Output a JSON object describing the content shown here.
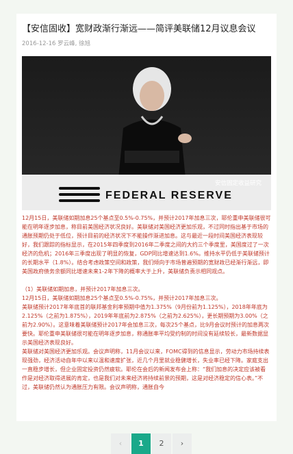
{
  "article": {
    "title": "【安信固收】宽财政渐行渐远——简评美联储12月议息会议",
    "meta": "2016-12-16 罗云峰, 徐旭",
    "image": {
      "podium_text": "FEDERAL RESERVE",
      "watermark": "安信固定收益研究"
    },
    "paragraphs": [
      "12月15日，美联储如期加息25个基点至0.5%-0.75%，并预计2017年加息三次，耶伦重申美联储很可能在明年逐步加息，称目前美国经济状况良好。美联储对美国经济更加乐观，不过同时指出基于市场的通胀预期仍处于低位，预计目前的经济状况下不能操作渐进加息。这与最近一段时间美国经济表现较好，我们跟踪的指标显示，在2015年四季度到2016年二季度之间的大约三个季度里，美国度过了一次经济的危机；2016年三季度出现了明显的恢复，GDP同比增速达到1.6%。维持水平仍低于美联储预计的长期水平（1.8%）。结合考虑政策空间和政策，我们倾向于市场普遍预期的宽财政已经渐行渐远，即美国政府债务余额同比增速未来1-2年下降的概率大于上升，美联储负责示相同观点。"
    ],
    "section_title": "（1）美联储如期加息，并预计2017年加息三次。",
    "section_lines": [
      "12月15日，美联储如期加息25个基点至0.5%-0.75%，并预计2017年加息三次。",
      "美联储预计2017年年底首的联邦基金利率预期中值为1.375%（9月份前为1.125%），2018年年底为2.125%（之前为1.875%），2019年年底前为2.875%（之前为2.625%），更长期预期为3.00%（之前为2.90%）。这意味着美联储预计2017年会加息三次，每次25个基点，比9月会议时预计的加息两次要快。耶伦重申美联储很可能在明年逐步加息，称通胀率平均受约制的时间没有延续较长，最新数据显示美国经济表现良好。",
      "美联储对美国经济更加乐观。会议声明称，11月会议以来，FOMC得到的信息显示，劳动力市场持续表现强劲，经济活动自年中以来以温和速度扩张，近几个月里就业稳健增长，失业率已经下降。家庭支出一直稳步增长，但企业固定投资仍然疲软。耶伦在会后的新闻发布会上称：“我们加息的决定应该被看作是对经济取得进展的肯定，也是我们对未来经济将持续前景的预期，这是对经济稳定的信心表。”不过，美联储仍然认为通胀压力有限。会议声明称，通胀自今"
    ]
  },
  "pagination": {
    "prev": "‹",
    "pages": [
      "1",
      "2"
    ],
    "next": "›",
    "current": "1"
  }
}
